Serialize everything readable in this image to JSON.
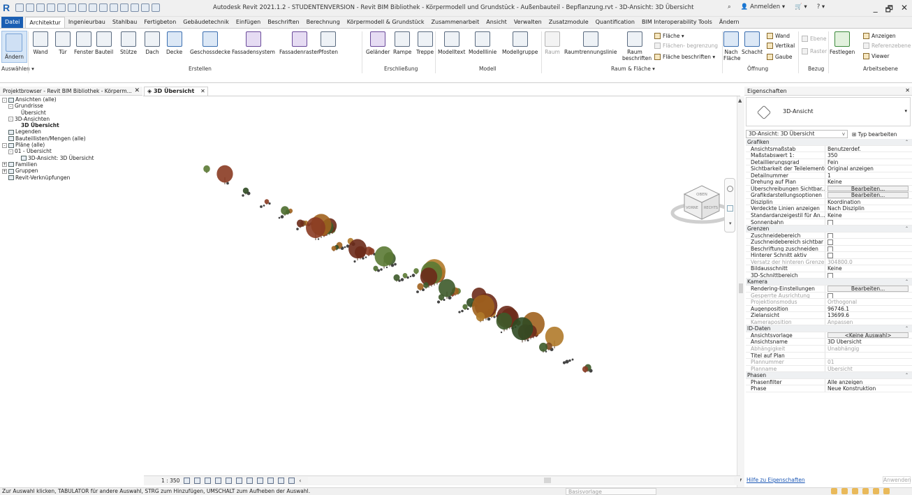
{
  "app": {
    "logo": "R",
    "title": "Autodesk Revit 2021.1.2 - STUDENTENVERSION - Revit BIM Bibliothek - Körpermodell und Grundstück - Außenbauteil - Bepflanzung.rvt - 3D-Ansicht: 3D Übersicht",
    "login": "Anmelden",
    "window_controls": [
      "_",
      "🗗",
      "✕"
    ]
  },
  "tabs": [
    "Datei",
    "Architektur",
    "Ingenieurbau",
    "Stahlbau",
    "Fertigbeton",
    "Gebäudetechnik",
    "Einfügen",
    "Beschriften",
    "Berechnung",
    "Körpermodell & Grundstück",
    "Zusammenarbeit",
    "Ansicht",
    "Verwalten",
    "Zusatzmodule",
    "Quantification",
    "BIM Interoperability Tools",
    "Ändern"
  ],
  "ribbon": {
    "modify": "Ändern",
    "select": "Auswählen ▾",
    "build": [
      "Wand",
      "Tür",
      "Fenster",
      "Bauteil",
      "Stütze",
      "Dach",
      "Decke",
      "Geschossdecke",
      "Fassadensystem",
      "Fassadenraster",
      "Pfosten"
    ],
    "build_label": "Erstellen",
    "circ": [
      "Geländer",
      "Rampe",
      "Treppe"
    ],
    "circ_label": "Erschließung",
    "model": [
      "Modelltext",
      "Modelllinie",
      "Modellgruppe"
    ],
    "model_label": "Modell",
    "room": [
      "Raum",
      "Raumtrennungslinie",
      "Raum beschriften"
    ],
    "area": [
      "Fläche ▾",
      "Flächen- begrenzung",
      "Fläche beschriften ▾"
    ],
    "room_label": "Raum & Fläche ▾",
    "opening": [
      "Nach Fläche",
      "Schacht",
      "Wand",
      "Vertikal",
      "Gaube"
    ],
    "opening_label": "Öffnung",
    "datum": [
      "Ebene",
      "Raster"
    ],
    "datum_label": "Bezug",
    "work": [
      "Festlegen",
      "Anzeigen",
      "Referenzebene",
      "Viewer"
    ],
    "work_label": "Arbeitsebene"
  },
  "browser": {
    "title": "Projektbrowser - Revit BIM Bibliothek - Körperm...",
    "nodes": [
      {
        "t": "Ansichten (alle)",
        "d": 0,
        "ex": "-"
      },
      {
        "t": "Grundrisse",
        "d": 1,
        "ex": "-"
      },
      {
        "t": "Übersicht",
        "d": 2,
        "ex": ""
      },
      {
        "t": "3D-Ansichten",
        "d": 1,
        "ex": "-"
      },
      {
        "t": "3D Übersicht",
        "d": 2,
        "ex": "",
        "bold": true
      },
      {
        "t": "Legenden",
        "d": 0,
        "ex": ""
      },
      {
        "t": "Bauteillisten/Mengen (alle)",
        "d": 0,
        "ex": ""
      },
      {
        "t": "Pläne (alle)",
        "d": 0,
        "ex": "-"
      },
      {
        "t": "01 - Übersicht",
        "d": 1,
        "ex": "-"
      },
      {
        "t": "3D-Ansicht: 3D Übersicht",
        "d": 2,
        "ex": ""
      },
      {
        "t": "Familien",
        "d": 0,
        "ex": "+"
      },
      {
        "t": "Gruppen",
        "d": 0,
        "ex": "+"
      },
      {
        "t": "Revit-Verknüpfungen",
        "d": 0,
        "ex": ""
      }
    ]
  },
  "view": {
    "tab": "3D Übersicht",
    "scale": "1 : 350"
  },
  "properties": {
    "title": "Eigenschaften",
    "type": "3D-Ansicht",
    "instance": "3D-Ansicht: 3D Übersicht",
    "edit_type": "Typ bearbeiten",
    "rows": [
      {
        "g": "Grafiken"
      },
      {
        "k": "Ansichtsmaßstab",
        "v": "Benutzerdef."
      },
      {
        "k": "Maßstabswert 1:",
        "v": "350"
      },
      {
        "k": "Detaillierungsgrad",
        "v": "Fein"
      },
      {
        "k": "Sichtbarkeit der Teilelemente",
        "v": "Original anzeigen"
      },
      {
        "k": "Detailnummer",
        "v": "1"
      },
      {
        "k": "Drehung auf Plan",
        "v": "Keine"
      },
      {
        "k": "Überschreibungen Sichtbar...",
        "btn": "Bearbeiten..."
      },
      {
        "k": "Grafikdarstellungsoptionen",
        "btn": "Bearbeiten..."
      },
      {
        "k": "Disziplin",
        "v": "Koordination"
      },
      {
        "k": "Verdeckte Linien anzeigen",
        "v": "Nach Disziplin"
      },
      {
        "k": "Standardanzeigestil für An...",
        "v": "Keine"
      },
      {
        "k": "Sonnenbahn",
        "cb": true
      },
      {
        "g": "Grenzen"
      },
      {
        "k": "Zuschneidebereich",
        "cb": true
      },
      {
        "k": "Zuschneidebereich sichtbar",
        "cb": true
      },
      {
        "k": "Beschriftung zuschneiden",
        "cb": true
      },
      {
        "k": "Hinterer Schnitt aktiv",
        "cb": true
      },
      {
        "k": "Versatz der hinteren Grenze",
        "v": "304800.0",
        "gray": true
      },
      {
        "k": "Bildausschnitt",
        "v": "Keine"
      },
      {
        "k": "3D-Schnittbereich",
        "cb": true
      },
      {
        "g": "Kamera"
      },
      {
        "k": "Rendering-Einstellungen",
        "btn": "Bearbeiten..."
      },
      {
        "k": "Gesperrte Ausrichtung",
        "cb": true,
        "gray": true
      },
      {
        "k": "Projektionsmodus",
        "v": "Orthogonal",
        "gray": true
      },
      {
        "k": "Augenposition",
        "v": "96746.1"
      },
      {
        "k": "Zielansicht",
        "v": "13699.6"
      },
      {
        "k": "Kameraposition",
        "v": "Anpassen",
        "gray": true
      },
      {
        "g": "ID-Daten"
      },
      {
        "k": "Ansichtsvorlage",
        "btn": "<Keine Auswahl>"
      },
      {
        "k": "Ansichtsname",
        "v": "3D Übersicht"
      },
      {
        "k": "Abhängigkeit",
        "v": "Unabhängig",
        "gray": true
      },
      {
        "k": "Titel auf Plan",
        "v": ""
      },
      {
        "k": "Plannummer",
        "v": "01",
        "gray": true
      },
      {
        "k": "Planname",
        "v": "Übersicht",
        "gray": true
      },
      {
        "g": "Phasen"
      },
      {
        "k": "Phasenfilter",
        "v": "Alle anzeigen"
      },
      {
        "k": "Phase",
        "v": "Neue Konstruktion"
      }
    ],
    "help": "Hilfe zu Eigenschaften",
    "apply": "Anwenden"
  },
  "status": {
    "message": "Zur Auswahl klicken, TABULATOR für andere Auswahl, STRG zum Hinzufügen, UMSCHALT zum Aufheben der Auswahl.",
    "workset": "Basisvorlage"
  },
  "viewcube": {
    "top": "OBEN",
    "left": "VORNE",
    "right": "RECHTS"
  }
}
